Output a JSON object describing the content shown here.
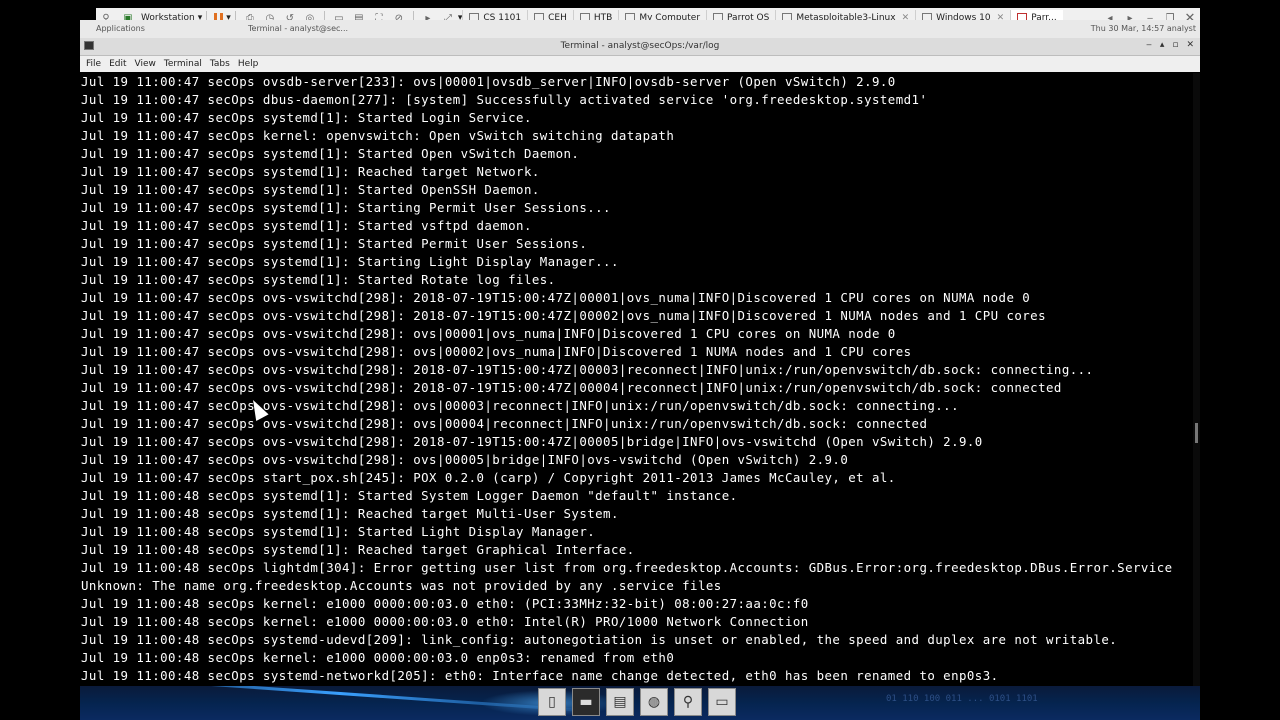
{
  "vm_toolbar": {
    "workstation_label": "Workstation",
    "tabs": [
      {
        "label": "CS 1101",
        "active": false
      },
      {
        "label": "CEH",
        "active": false
      },
      {
        "label": "HTB",
        "active": false
      },
      {
        "label": "My Computer",
        "active": false
      },
      {
        "label": "Parrot OS",
        "active": false
      },
      {
        "label": "Metasploitable3-Linux",
        "active": false
      },
      {
        "label": "Windows 10",
        "active": false
      },
      {
        "label": "Parr...",
        "active": true
      }
    ]
  },
  "guest_panel": {
    "applications_label": "Applications",
    "terminal_task": "Terminal - analyst@sec...",
    "clock": "Thu 30 Mar, 14:57 analyst"
  },
  "window": {
    "title": "Terminal - analyst@secOps:/var/log",
    "controls": [
      "‒",
      "▴",
      "▫",
      "✕"
    ]
  },
  "menubar": [
    "File",
    "Edit",
    "View",
    "Terminal",
    "Tabs",
    "Help"
  ],
  "terminal": {
    "lines": [
      "Jul 19 11:00:47 secOps ovsdb-server[233]: ovs|00001|ovsdb_server|INFO|ovsdb-server (Open vSwitch) 2.9.0",
      "Jul 19 11:00:47 secOps dbus-daemon[277]: [system] Successfully activated service 'org.freedesktop.systemd1'",
      "Jul 19 11:00:47 secOps systemd[1]: Started Login Service.",
      "Jul 19 11:00:47 secOps kernel: openvswitch: Open vSwitch switching datapath",
      "Jul 19 11:00:47 secOps systemd[1]: Started Open vSwitch Daemon.",
      "Jul 19 11:00:47 secOps systemd[1]: Reached target Network.",
      "Jul 19 11:00:47 secOps systemd[1]: Started OpenSSH Daemon.",
      "Jul 19 11:00:47 secOps systemd[1]: Starting Permit User Sessions...",
      "Jul 19 11:00:47 secOps systemd[1]: Started vsftpd daemon.",
      "Jul 19 11:00:47 secOps systemd[1]: Started Permit User Sessions.",
      "Jul 19 11:00:47 secOps systemd[1]: Starting Light Display Manager...",
      "Jul 19 11:00:47 secOps systemd[1]: Started Rotate log files.",
      "Jul 19 11:00:47 secOps ovs-vswitchd[298]: 2018-07-19T15:00:47Z|00001|ovs_numa|INFO|Discovered 1 CPU cores on NUMA node 0",
      "Jul 19 11:00:47 secOps ovs-vswitchd[298]: 2018-07-19T15:00:47Z|00002|ovs_numa|INFO|Discovered 1 NUMA nodes and 1 CPU cores",
      "Jul 19 11:00:47 secOps ovs-vswitchd[298]: ovs|00001|ovs_numa|INFO|Discovered 1 CPU cores on NUMA node 0",
      "Jul 19 11:00:47 secOps ovs-vswitchd[298]: ovs|00002|ovs_numa|INFO|Discovered 1 NUMA nodes and 1 CPU cores",
      "Jul 19 11:00:47 secOps ovs-vswitchd[298]: 2018-07-19T15:00:47Z|00003|reconnect|INFO|unix:/run/openvswitch/db.sock: connecting...",
      "Jul 19 11:00:47 secOps ovs-vswitchd[298]: 2018-07-19T15:00:47Z|00004|reconnect|INFO|unix:/run/openvswitch/db.sock: connected",
      "Jul 19 11:00:47 secOps ovs-vswitchd[298]: ovs|00003|reconnect|INFO|unix:/run/openvswitch/db.sock: connecting...",
      "Jul 19 11:00:47 secOps ovs-vswitchd[298]: ovs|00004|reconnect|INFO|unix:/run/openvswitch/db.sock: connected",
      "Jul 19 11:00:47 secOps ovs-vswitchd[298]: 2018-07-19T15:00:47Z|00005|bridge|INFO|ovs-vswitchd (Open vSwitch) 2.9.0",
      "Jul 19 11:00:47 secOps ovs-vswitchd[298]: ovs|00005|bridge|INFO|ovs-vswitchd (Open vSwitch) 2.9.0",
      "Jul 19 11:00:47 secOps start_pox.sh[245]: POX 0.2.0 (carp) / Copyright 2011-2013 James McCauley, et al.",
      "Jul 19 11:00:48 secOps systemd[1]: Started System Logger Daemon \"default\" instance.",
      "Jul 19 11:00:48 secOps systemd[1]: Reached target Multi-User System.",
      "Jul 19 11:00:48 secOps systemd[1]: Started Light Display Manager.",
      "Jul 19 11:00:48 secOps systemd[1]: Reached target Graphical Interface.",
      "Jul 19 11:00:48 secOps lightdm[304]: Error getting user list from org.freedesktop.Accounts: GDBus.Error:org.freedesktop.DBus.Error.Service",
      "Unknown: The name org.freedesktop.Accounts was not provided by any .service files",
      "Jul 19 11:00:48 secOps kernel: e1000 0000:00:03.0 eth0: (PCI:33MHz:32-bit) 08:00:27:aa:0c:f0",
      "Jul 19 11:00:48 secOps kernel: e1000 0000:00:03.0 eth0: Intel(R) PRO/1000 Network Connection",
      "Jul 19 11:00:48 secOps systemd-udevd[209]: link_config: autonegotiation is unset or enabled, the speed and duplex are not writable.",
      "Jul 19 11:00:48 secOps kernel: e1000 0000:00:03.0 enp0s3: renamed from eth0",
      "Jul 19 11:00:48 secOps systemd-networkd[205]: eth0: Interface name change detected, eth0 has been renamed to enp0s3."
    ]
  },
  "taskbar": {
    "launcher_icons": [
      "file-manager-icon",
      "terminal-icon",
      "files-icon",
      "browser-icon",
      "search-icon",
      "folder-icon"
    ],
    "watermark": "01 110 100 011 ... 0101 1101"
  },
  "colors": {
    "terminal_bg": "#000000",
    "terminal_fg": "#ffffff",
    "accent_orange": "#e07020"
  }
}
